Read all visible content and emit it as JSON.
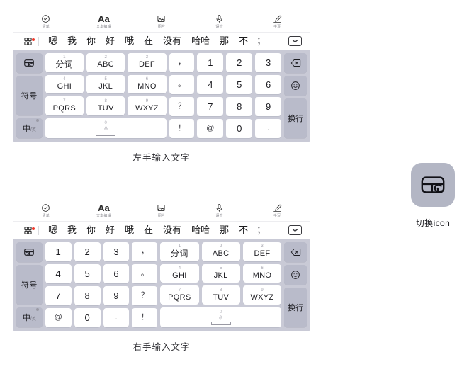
{
  "toolbar": {
    "items": [
      {
        "icon": "checklist-icon",
        "label": "清单"
      },
      {
        "icon": "text-format-icon",
        "label": "文本编辑",
        "glyph": "Aa"
      },
      {
        "icon": "image-icon",
        "label": "图片"
      },
      {
        "icon": "microphone-icon",
        "label": "语音"
      },
      {
        "icon": "handwriting-icon",
        "label": "手写"
      }
    ]
  },
  "candidates": {
    "grid_icon": "apps-grid-icon",
    "badge": true,
    "items": [
      "嗯",
      "我",
      "你",
      "好",
      "哦",
      "在",
      "没有",
      "哈哈",
      "那",
      "不",
      "；"
    ],
    "collapse_icon": "chevron-down-icon"
  },
  "keys": {
    "switch_icon": "keyboard-switch-icon",
    "symbol_label": "符号",
    "lang_cn": "中",
    "lang_slash": "/",
    "lang_en": "英",
    "t9": [
      {
        "num": "1",
        "main": "分词"
      },
      {
        "num": "2",
        "main": "ABC"
      },
      {
        "num": "3",
        "main": "DEF"
      },
      {
        "num": "4",
        "main": "GHI"
      },
      {
        "num": "5",
        "main": "JKL"
      },
      {
        "num": "6",
        "main": "MNO"
      },
      {
        "num": "7",
        "main": "PQRS"
      },
      {
        "num": "8",
        "main": "TUV"
      },
      {
        "num": "9",
        "main": "WXYZ"
      }
    ],
    "space": {
      "num": "0",
      "icon": "microphone-icon"
    },
    "punctuation": [
      "，",
      "。",
      "？",
      "！"
    ],
    "numpad": [
      "1",
      "2",
      "3",
      "4",
      "5",
      "6",
      "7",
      "8",
      "9",
      "@",
      "0",
      "."
    ],
    "delete_icon": "backspace-icon",
    "emoji_icon": "smiley-icon",
    "enter_label": "换行"
  },
  "captions": {
    "left": "左手输入文字",
    "right": "右手输入文字"
  },
  "icon_panel": {
    "icon": "keyboard-switch-icon",
    "label": "切换icon"
  },
  "colors": {
    "keyboard_bg": "#c9cad6",
    "key_light": "#ffffff",
    "key_dark": "#b9bbca",
    "tile_bg": "#b3b6c4",
    "badge": "#f0392b"
  }
}
